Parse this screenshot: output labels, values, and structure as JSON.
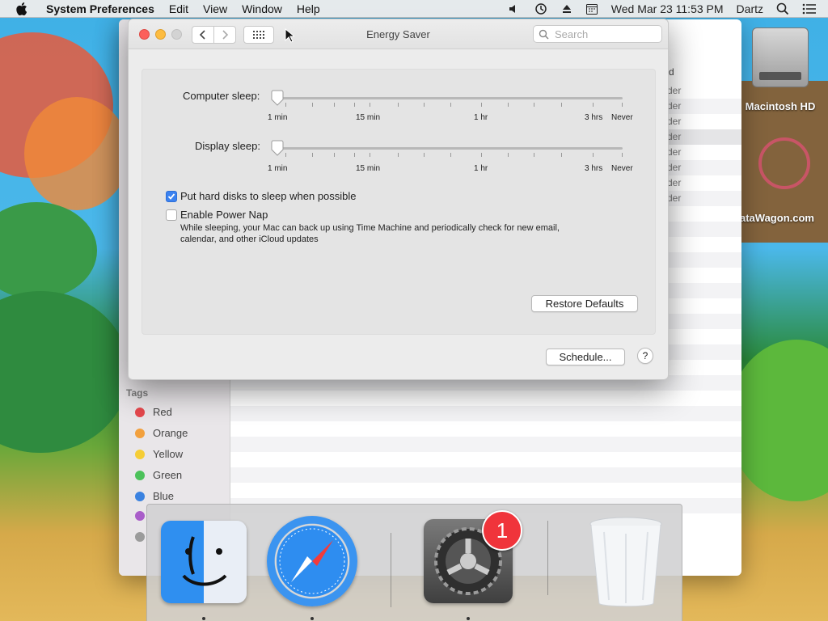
{
  "menubar": {
    "app_name": "System Preferences",
    "menus": [
      "Edit",
      "View",
      "Window",
      "Help"
    ],
    "clock": "Wed Mar 23  11:53 PM",
    "user": "Dartz"
  },
  "desktop": {
    "hd_label": "Macintosh HD",
    "wagon_label": "ataWagon.com"
  },
  "finder": {
    "rows": [
      "der",
      "der",
      "der",
      "der",
      "der",
      "der",
      "der",
      "der"
    ],
    "header_fragment": "d",
    "tags_title": "Tags",
    "tags": [
      {
        "label": "Red",
        "color": "#e5484d"
      },
      {
        "label": "Orange",
        "color": "#f2a03d"
      },
      {
        "label": "Yellow",
        "color": "#f5cd36"
      },
      {
        "label": "Green",
        "color": "#4cc15a"
      },
      {
        "label": "Blue",
        "color": "#3b82e0"
      },
      {
        "label": "",
        "color": "#a95dc9"
      },
      {
        "label": "",
        "color": "#9b9b9b"
      }
    ]
  },
  "energy": {
    "title": "Energy Saver",
    "search_placeholder": "Search",
    "computer_sleep_label": "Computer sleep:",
    "display_sleep_label": "Display sleep:",
    "ticks": [
      "1 min",
      "15 min",
      "1 hr",
      "3 hrs",
      "Never"
    ],
    "hard_disks_label": "Put hard disks to sleep when possible",
    "hard_disks_checked": true,
    "power_nap_label": "Enable Power Nap",
    "power_nap_checked": false,
    "power_nap_desc_1": "While sleeping, your Mac can back up using Time Machine and periodically check for new email,",
    "power_nap_desc_2": "calendar, and other iCloud updates",
    "restore_defaults": "Restore Defaults",
    "schedule": "Schedule...",
    "help": "?"
  },
  "dock": {
    "badge": "1"
  },
  "colors": {
    "close": "#fc605b",
    "minimize": "#fdbc40",
    "zoom_disabled": "#d3d3d3",
    "checkbox_blue": "#3b82f0",
    "badge_red": "#f0343b"
  }
}
